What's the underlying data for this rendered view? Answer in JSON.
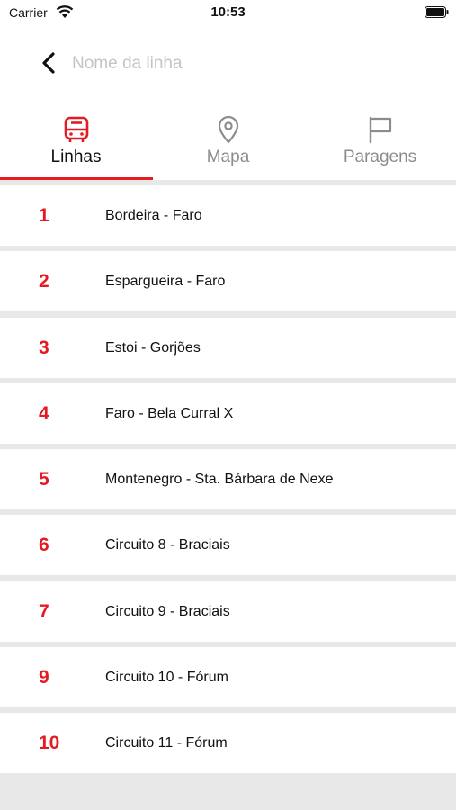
{
  "status_bar": {
    "carrier": "Carrier",
    "time": "10:53"
  },
  "header": {
    "search_placeholder": "Nome da linha",
    "search_value": ""
  },
  "tabs": [
    {
      "label": "Linhas",
      "icon": "bus-icon",
      "active": true
    },
    {
      "label": "Mapa",
      "icon": "map-pin-icon",
      "active": false
    },
    {
      "label": "Paragens",
      "icon": "flag-icon",
      "active": false
    }
  ],
  "colors": {
    "accent": "#e31b23",
    "inactive": "#8c8c8c",
    "separator": "#e8e8e8"
  },
  "lines": [
    {
      "number": "1",
      "name": "Bordeira - Faro"
    },
    {
      "number": "2",
      "name": "Espargueira - Faro"
    },
    {
      "number": "3",
      "name": "Estoi - Gorjões"
    },
    {
      "number": "4",
      "name": "Faro - Bela Curral X"
    },
    {
      "number": "5",
      "name": "Montenegro - Sta. Bárbara de Nexe"
    },
    {
      "number": "6",
      "name": "Circuito 8 - Braciais"
    },
    {
      "number": "7",
      "name": "Circuito 9 - Braciais"
    },
    {
      "number": "9",
      "name": "Circuito 10 - Fórum"
    },
    {
      "number": "10",
      "name": "Circuito 11 - Fórum"
    }
  ]
}
